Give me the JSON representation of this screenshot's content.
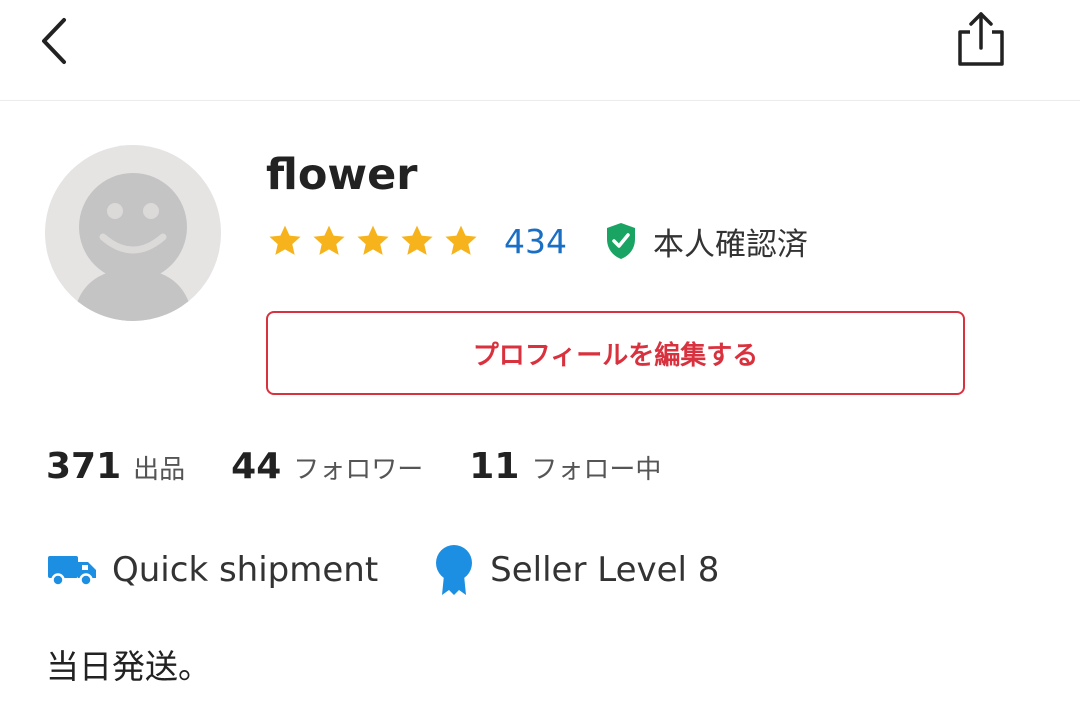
{
  "header": {
    "back_icon": "chevron-left-icon",
    "share_icon": "share-icon"
  },
  "profile": {
    "username": "flower",
    "avatar_icon": "default-avatar-icon",
    "rating": 5,
    "review_count": "434",
    "verified_label": "本人確認済",
    "verified_icon": "shield-check-icon",
    "edit_button_label": "プロフィールを編集する"
  },
  "stats": [
    {
      "value": "371",
      "label": "出品"
    },
    {
      "value": "44",
      "label": "フォロワー"
    },
    {
      "value": "11",
      "label": "フォロー中"
    }
  ],
  "badges": [
    {
      "icon": "truck-icon",
      "label": "Quick shipment"
    },
    {
      "icon": "medal-icon",
      "label": "Seller Level 8"
    }
  ],
  "bio": "当日発送。",
  "colors": {
    "accent": "#d9323f",
    "link": "#1a6fc4",
    "star": "#f6b31b",
    "verified": "#1aa463",
    "badge": "#1d8fe3"
  }
}
